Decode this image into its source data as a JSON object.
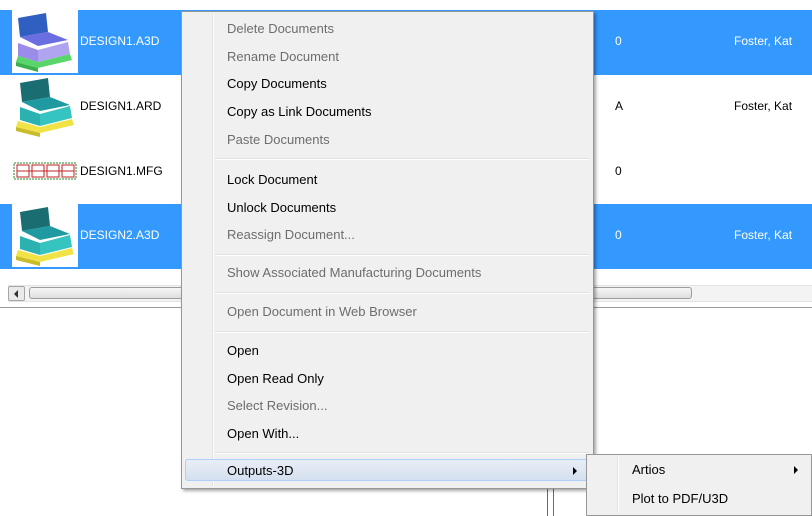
{
  "file_list": {
    "rows": [
      {
        "name": "DESIGN1.A3D",
        "revision": "0",
        "owner": "Foster, Kat",
        "selected": true,
        "thumbnail": "3d-box-purple-icon"
      },
      {
        "name": "DESIGN1.ARD",
        "revision": "A",
        "owner": "Foster, Kat",
        "selected": false,
        "thumbnail": "3d-box-teal-icon"
      },
      {
        "name": "DESIGN1.MFG",
        "revision": "0",
        "owner": "",
        "selected": false,
        "thumbnail": "manufacturing-layout-icon"
      },
      {
        "name": "DESIGN2.A3D",
        "revision": "0",
        "owner": "Foster, Kat",
        "selected": true,
        "thumbnail": "3d-box-teal-icon"
      }
    ]
  },
  "context_menu": {
    "items": [
      {
        "label": "Delete Documents",
        "enabled": false
      },
      {
        "label": "Rename Document",
        "enabled": false
      },
      {
        "label": "Copy Documents",
        "enabled": true
      },
      {
        "label": "Copy as Link Documents",
        "enabled": true
      },
      {
        "label": "Paste Documents",
        "enabled": false
      },
      {
        "label": "Lock Document",
        "enabled": true
      },
      {
        "label": "Unlock Documents",
        "enabled": true
      },
      {
        "label": "Reassign Document...",
        "enabled": false
      },
      {
        "label": "Show Associated Manufacturing Documents",
        "enabled": false
      },
      {
        "label": "Open Document in Web Browser",
        "enabled": false
      },
      {
        "label": "Open",
        "enabled": true
      },
      {
        "label": "Open Read Only",
        "enabled": true
      },
      {
        "label": "Select Revision...",
        "enabled": false
      },
      {
        "label": "Open With...",
        "enabled": true
      },
      {
        "label": "Outputs-3D",
        "enabled": true,
        "highlighted": true,
        "has_submenu": true
      }
    ]
  },
  "submenu": {
    "items": [
      {
        "label": "Artios",
        "has_submenu": true
      },
      {
        "label": "Plot to PDF/U3D",
        "has_submenu": false
      }
    ]
  },
  "colors": {
    "selection": "#3399ff",
    "menu_background": "#f0f0f0",
    "disabled_text": "#6d6d6d"
  }
}
